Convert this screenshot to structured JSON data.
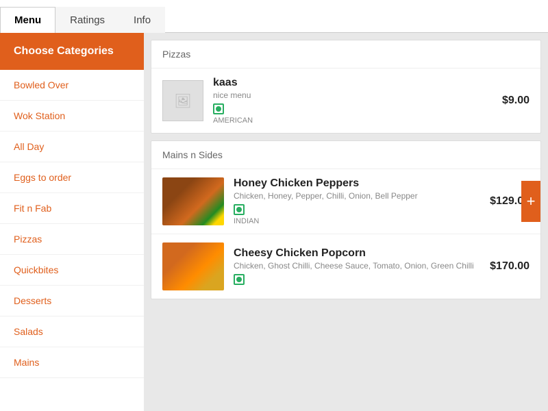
{
  "tabs": [
    {
      "label": "Menu",
      "active": true
    },
    {
      "label": "Ratings",
      "active": false
    },
    {
      "label": "Info",
      "active": false
    }
  ],
  "sidebar": {
    "choose_label": "Choose Categories",
    "items": [
      {
        "label": "Bowled Over"
      },
      {
        "label": "Wok Station"
      },
      {
        "label": "All Day"
      },
      {
        "label": "Eggs to order"
      },
      {
        "label": "Fit n Fab"
      },
      {
        "label": "Pizzas"
      },
      {
        "label": "Quickbites"
      },
      {
        "label": "Desserts"
      },
      {
        "label": "Salads"
      },
      {
        "label": "Mains"
      }
    ]
  },
  "sections": [
    {
      "title": "Pizzas",
      "items": [
        {
          "name": "kaas",
          "desc": "nice menu",
          "cuisine": "AMERICAN",
          "price": "$9.00",
          "has_image": false,
          "veg": true
        }
      ]
    },
    {
      "title": "Mains n Sides",
      "items": [
        {
          "name": "Honey Chicken Peppers",
          "desc": "Chicken, Honey, Pepper, Chilli, Onion, Bell Pepper",
          "cuisine": "INDIAN",
          "price": "$129.00",
          "has_image": true,
          "image_class": "food-img-honey",
          "veg": true,
          "has_add_btn": true
        },
        {
          "name": "Cheesy Chicken Popcorn",
          "desc": "Chicken, Ghost Chilli, Cheese Sauce, Tomato, Onion, Green Chilli",
          "cuisine": "",
          "price": "$170.00",
          "has_image": true,
          "image_class": "food-img-cheesy",
          "veg": true,
          "has_add_btn": false
        }
      ]
    }
  ]
}
